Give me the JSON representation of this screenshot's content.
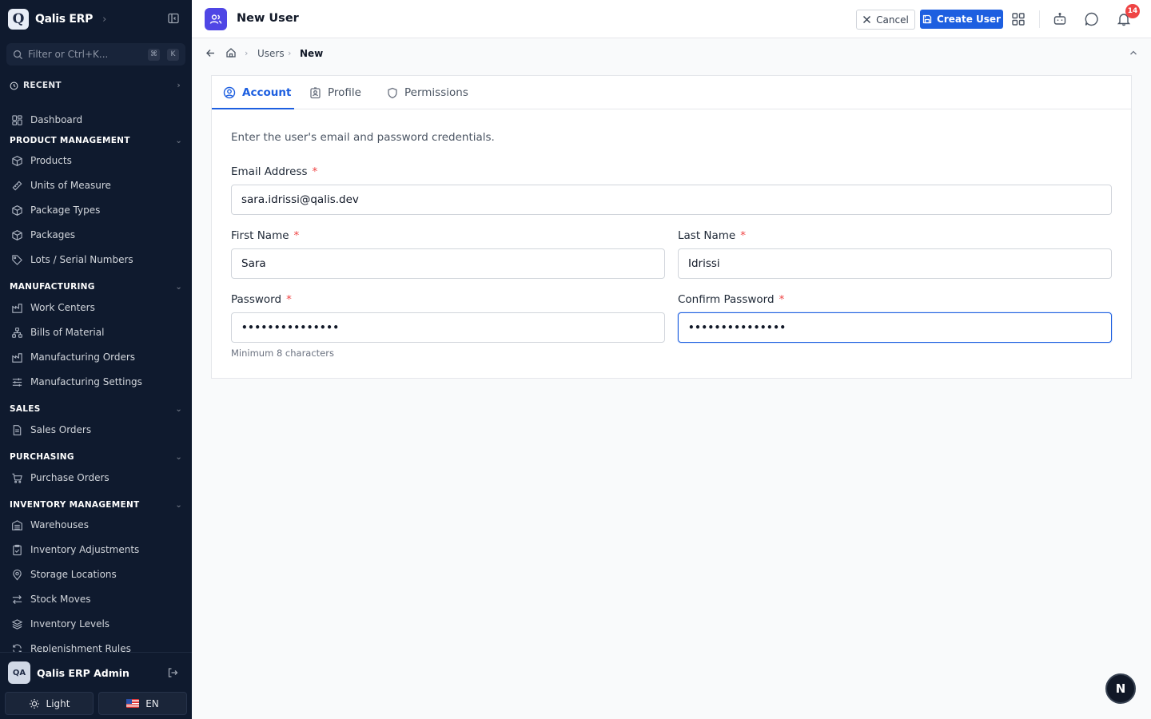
{
  "app": {
    "name": "Qalis ERP",
    "logo_letter": "Q"
  },
  "sidebar": {
    "filter_placeholder": "Filter or Ctrl+K...",
    "filter_keys": [
      "⌘",
      "K"
    ],
    "recent_label": "RECENT",
    "items": [
      {
        "label": "Dashboard",
        "icon": "dashboard-icon"
      },
      {
        "section": "PRODUCT MANAGEMENT"
      },
      {
        "label": "Products",
        "icon": "box-icon"
      },
      {
        "label": "Units of Measure",
        "icon": "ruler-icon"
      },
      {
        "label": "Package Types",
        "icon": "box-icon"
      },
      {
        "label": "Packages",
        "icon": "box-icon"
      },
      {
        "label": "Lots / Serial Numbers",
        "icon": "tag-icon"
      },
      {
        "section": "MANUFACTURING"
      },
      {
        "label": "Work Centers",
        "icon": "factory-icon"
      },
      {
        "label": "Bills of Material",
        "icon": "network-icon"
      },
      {
        "label": "Manufacturing Orders",
        "icon": "factory-icon"
      },
      {
        "label": "Manufacturing Settings",
        "icon": "sliders-icon"
      },
      {
        "section": "SALES"
      },
      {
        "label": "Sales Orders",
        "icon": "document-icon"
      },
      {
        "section": "PURCHASING"
      },
      {
        "label": "Purchase Orders",
        "icon": "cart-icon"
      },
      {
        "section": "INVENTORY MANAGEMENT"
      },
      {
        "label": "Warehouses",
        "icon": "warehouse-icon"
      },
      {
        "label": "Inventory Adjustments",
        "icon": "clipboard-check-icon"
      },
      {
        "label": "Storage Locations",
        "icon": "map-pin-icon"
      },
      {
        "label": "Stock Moves",
        "icon": "arrows-icon"
      },
      {
        "label": "Inventory Levels",
        "icon": "layers-icon"
      },
      {
        "label": "Replenishment Rules",
        "icon": "refresh-icon"
      }
    ],
    "user": {
      "initials": "QA",
      "name": "Qalis ERP Admin"
    },
    "theme_label": "Light",
    "language_label": "EN"
  },
  "header": {
    "title": "New User",
    "cancel_label": "Cancel",
    "create_label": "Create User",
    "notification_count": "14"
  },
  "breadcrumb": {
    "items": [
      "Users",
      "New"
    ]
  },
  "form": {
    "tabs": [
      "Account",
      "Profile",
      "Permissions"
    ],
    "active_tab": "Account",
    "description": "Enter the user's email and password credentials.",
    "email": {
      "label": "Email Address",
      "value": "sara.idrissi@qalis.dev"
    },
    "first_name": {
      "label": "First Name",
      "value": "Sara"
    },
    "last_name": {
      "label": "Last Name",
      "value": "Idrissi"
    },
    "password": {
      "label": "Password",
      "value": "•••••••••••••••",
      "hint": "Minimum 8 characters"
    },
    "confirm_password": {
      "label": "Confirm Password",
      "value": "•••••••••••••••"
    },
    "required_marker": "*"
  },
  "fab_label": "N",
  "colors": {
    "accent": "#1d5fe0",
    "sidebar_bg": "#0f1a2e",
    "danger": "#ef4444"
  }
}
